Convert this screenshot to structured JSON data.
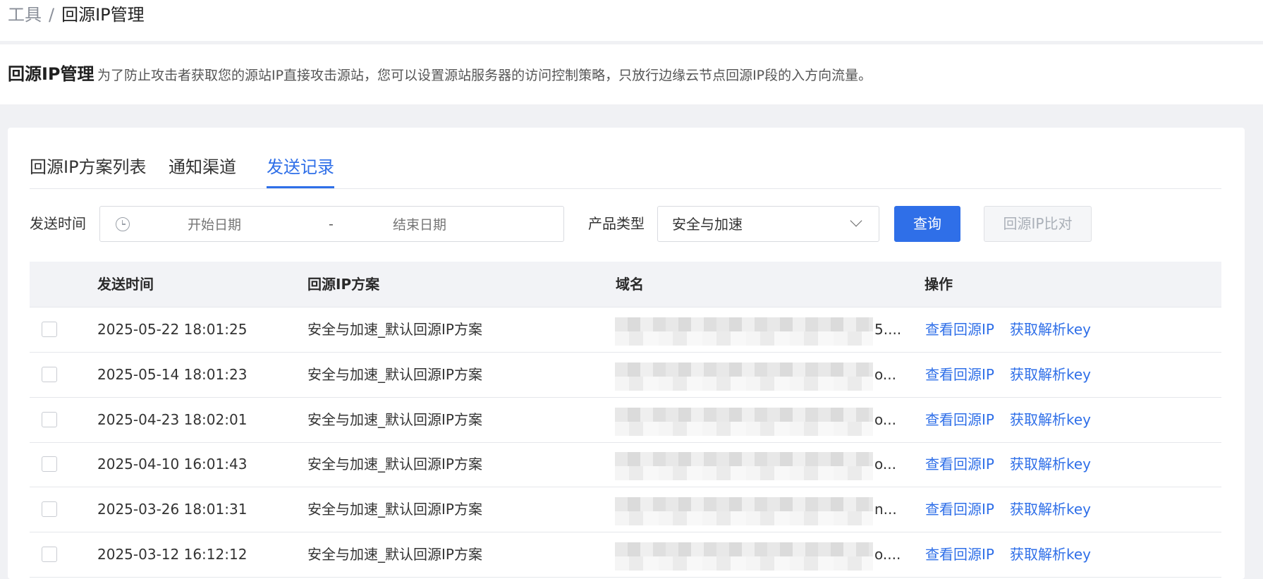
{
  "breadcrumb": {
    "parent": "工具",
    "separator": "/",
    "current": "回源IP管理"
  },
  "header": {
    "title": "回源IP管理",
    "description": "为了防止攻击者获取您的源站IP直接攻击源站，您可以设置源站服务器的访问控制策略，只放行边缘云节点回源IP段的入方向流量。"
  },
  "tabs": [
    {
      "label": "回源IP方案列表",
      "active": false
    },
    {
      "label": "通知渠道",
      "active": false
    },
    {
      "label": "发送记录",
      "active": true
    }
  ],
  "filters": {
    "send_time_label": "发送时间",
    "start_placeholder": "开始日期",
    "range_separator": "-",
    "end_placeholder": "结束日期",
    "product_type_label": "产品类型",
    "product_type_value": "安全与加速",
    "query_button": "查询",
    "compare_button": "回源IP比对"
  },
  "table": {
    "columns": [
      "发送时间",
      "回源IP方案",
      "域名",
      "操作"
    ],
    "rows": [
      {
        "time": "2025-05-22 18:01:25",
        "plan": "安全与加速_默认回源IP方案",
        "domain_tail": "5....",
        "action_view": "查看回源IP",
        "action_key": "获取解析key"
      },
      {
        "time": "2025-05-14 18:01:23",
        "plan": "安全与加速_默认回源IP方案",
        "domain_tail": "o...",
        "action_view": "查看回源IP",
        "action_key": "获取解析key"
      },
      {
        "time": "2025-04-23 18:02:01",
        "plan": "安全与加速_默认回源IP方案",
        "domain_tail": "o...",
        "action_view": "查看回源IP",
        "action_key": "获取解析key"
      },
      {
        "time": "2025-04-10 16:01:43",
        "plan": "安全与加速_默认回源IP方案",
        "domain_tail": "o...",
        "action_view": "查看回源IP",
        "action_key": "获取解析key"
      },
      {
        "time": "2025-03-26 18:01:31",
        "plan": "安全与加速_默认回源IP方案",
        "domain_tail": "n...",
        "action_view": "查看回源IP",
        "action_key": "获取解析key"
      },
      {
        "time": "2025-03-12 16:12:12",
        "plan": "安全与加速_默认回源IP方案",
        "domain_tail": "o....",
        "action_view": "查看回源IP",
        "action_key": "获取解析key"
      }
    ]
  },
  "colors": {
    "accent": "#2f6fe8",
    "page_bg": "#f0f1f4"
  }
}
